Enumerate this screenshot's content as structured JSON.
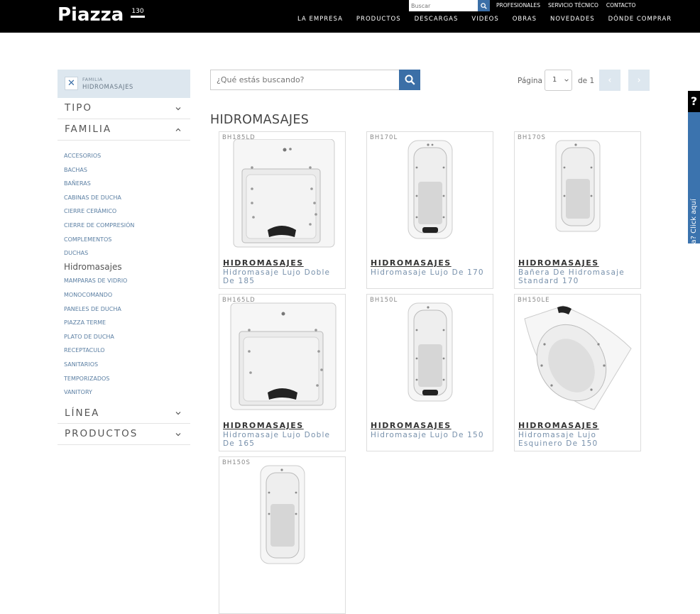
{
  "header": {
    "logo_text": "Piazza",
    "logo_badge": "130",
    "search_placeholder": "Buscar",
    "utility_links": [
      "PROFESIONALES",
      "SERVICIO TÉCNICO",
      "CONTACTO"
    ],
    "nav": [
      "LA EMPRESA",
      "PRODUCTOS",
      "DESCARGAS",
      "VIDEOS",
      "OBRAS",
      "NOVEDADES",
      "DÓNDE COMPRAR"
    ]
  },
  "sidebar": {
    "active_filter_label": "FAMILIA",
    "active_filter_value": "HIDROMASAJES",
    "sections": {
      "tipo": "TIPO",
      "familia": "FAMILIA",
      "linea": "LÍNEA",
      "productos": "PRODUCTOS"
    },
    "familia_items": [
      "ACCESORIOS",
      "BACHAS",
      "BAÑERAS",
      "CABINAS DE DUCHA",
      "CIERRE CERÁMICO",
      "CIERRE DE COMPRESIÓN",
      "COMPLEMENTOS",
      "DUCHAS",
      "Hidromasajes",
      "MAMPARAS DE VIDRIO",
      "MONOCOMANDO",
      "PANELES DE DUCHA",
      "PIAZZA TERME",
      "PLATO DE DUCHA",
      "RECEPTACULO",
      "SANITARIOS",
      "TEMPORIZADOS",
      "VANITORY"
    ],
    "active_item": "Hidromasajes"
  },
  "search": {
    "placeholder": "¿Qué estás buscando?"
  },
  "pagination": {
    "label": "Página",
    "current": "1",
    "of_label": "de 1"
  },
  "section_title": "HIDROMASAJES",
  "products": [
    {
      "code": "BH185LD",
      "category": "HIDROMASAJES",
      "name": "Hidromasaje Lujo Doble De 185",
      "icon": "wide-tub-image"
    },
    {
      "code": "BH170L",
      "category": "HIDROMASAJES",
      "name": "Hidromasaje Lujo De 170",
      "icon": "narrow-tub-image"
    },
    {
      "code": "BH170S",
      "category": "HIDROMASAJES",
      "name": "Bañera De Hidromasaje Standard 170",
      "icon": "narrow-tub-image"
    },
    {
      "code": "BH165LD",
      "category": "HIDROMASAJES",
      "name": "Hidromasaje Lujo Doble De 165",
      "icon": "wide-tub-image"
    },
    {
      "code": "BH150L",
      "category": "HIDROMASAJES",
      "name": "Hidromasaje Lujo De 150",
      "icon": "narrow-tub-image"
    },
    {
      "code": "BH150LE",
      "category": "HIDROMASAJES",
      "name": "Hidromasaje Lujo Esquinero De 150",
      "icon": "corner-tub-image"
    },
    {
      "code": "BH150S",
      "category": "",
      "name": "",
      "icon": "narrow-tub-image"
    }
  ],
  "help_tab": {
    "icon": "?",
    "text": "¿Necesita ayuda? Click aquí"
  },
  "colors": {
    "accent": "#3b6fa7",
    "filter_bg": "#dde7ef",
    "link": "#5b7fa3"
  }
}
